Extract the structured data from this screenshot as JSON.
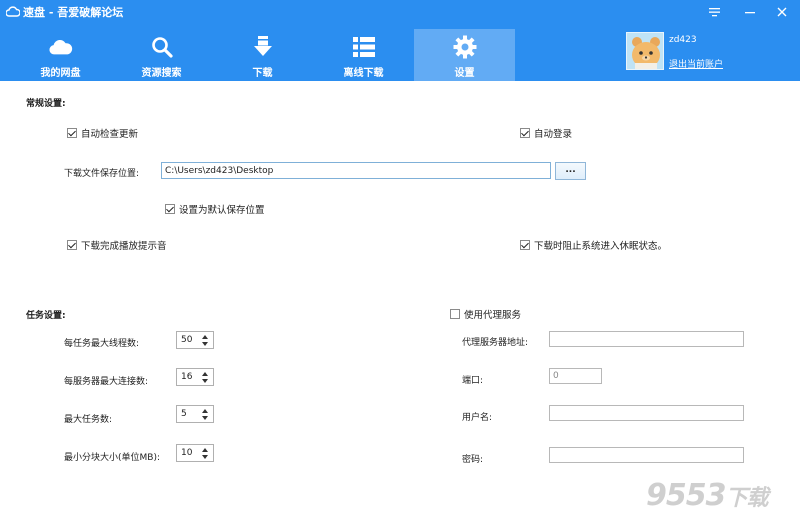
{
  "window": {
    "title": "速盘 - 吾爱破解论坛",
    "brand_color": "#2b8ef0"
  },
  "nav": {
    "items": [
      {
        "label": "我的网盘",
        "icon": "cloud-icon"
      },
      {
        "label": "资源搜索",
        "icon": "search-icon"
      },
      {
        "label": "下载",
        "icon": "download-icon"
      },
      {
        "label": "离线下载",
        "icon": "list-icon"
      },
      {
        "label": "设置",
        "icon": "gear-icon",
        "active": true
      }
    ]
  },
  "user": {
    "name": "zd423",
    "logout": "退出当前账户"
  },
  "general": {
    "title": "常规设置:",
    "auto_update": "自动检查更新",
    "auto_login": "自动登录",
    "save_path_label": "下载文件保存位置:",
    "save_path_value": "C:\\Users\\zd423\\Desktop",
    "browse": "...",
    "set_default": "设置为默认保存位置",
    "play_sound": "下载完成播放提示音",
    "prevent_sleep": "下载时阻止系统进入休眠状态。"
  },
  "task": {
    "title": "任务设置:",
    "max_threads_label": "每任务最大线程数:",
    "max_threads": "50",
    "max_conn_label": "每服务器最大连接数:",
    "max_conn": "16",
    "max_tasks_label": "最大任务数:",
    "max_tasks": "5",
    "min_chunk_label": "最小分块大小(单位MB):",
    "min_chunk": "10"
  },
  "proxy": {
    "use_proxy": "使用代理服务",
    "server_label": "代理服务器地址:",
    "server_value": "",
    "port_label": "端口:",
    "port_value": "0",
    "user_label": "用户名:",
    "user_value": "",
    "pass_label": "密码:",
    "pass_value": ""
  },
  "watermark": {
    "text": "9553",
    "suffix": "下载"
  }
}
